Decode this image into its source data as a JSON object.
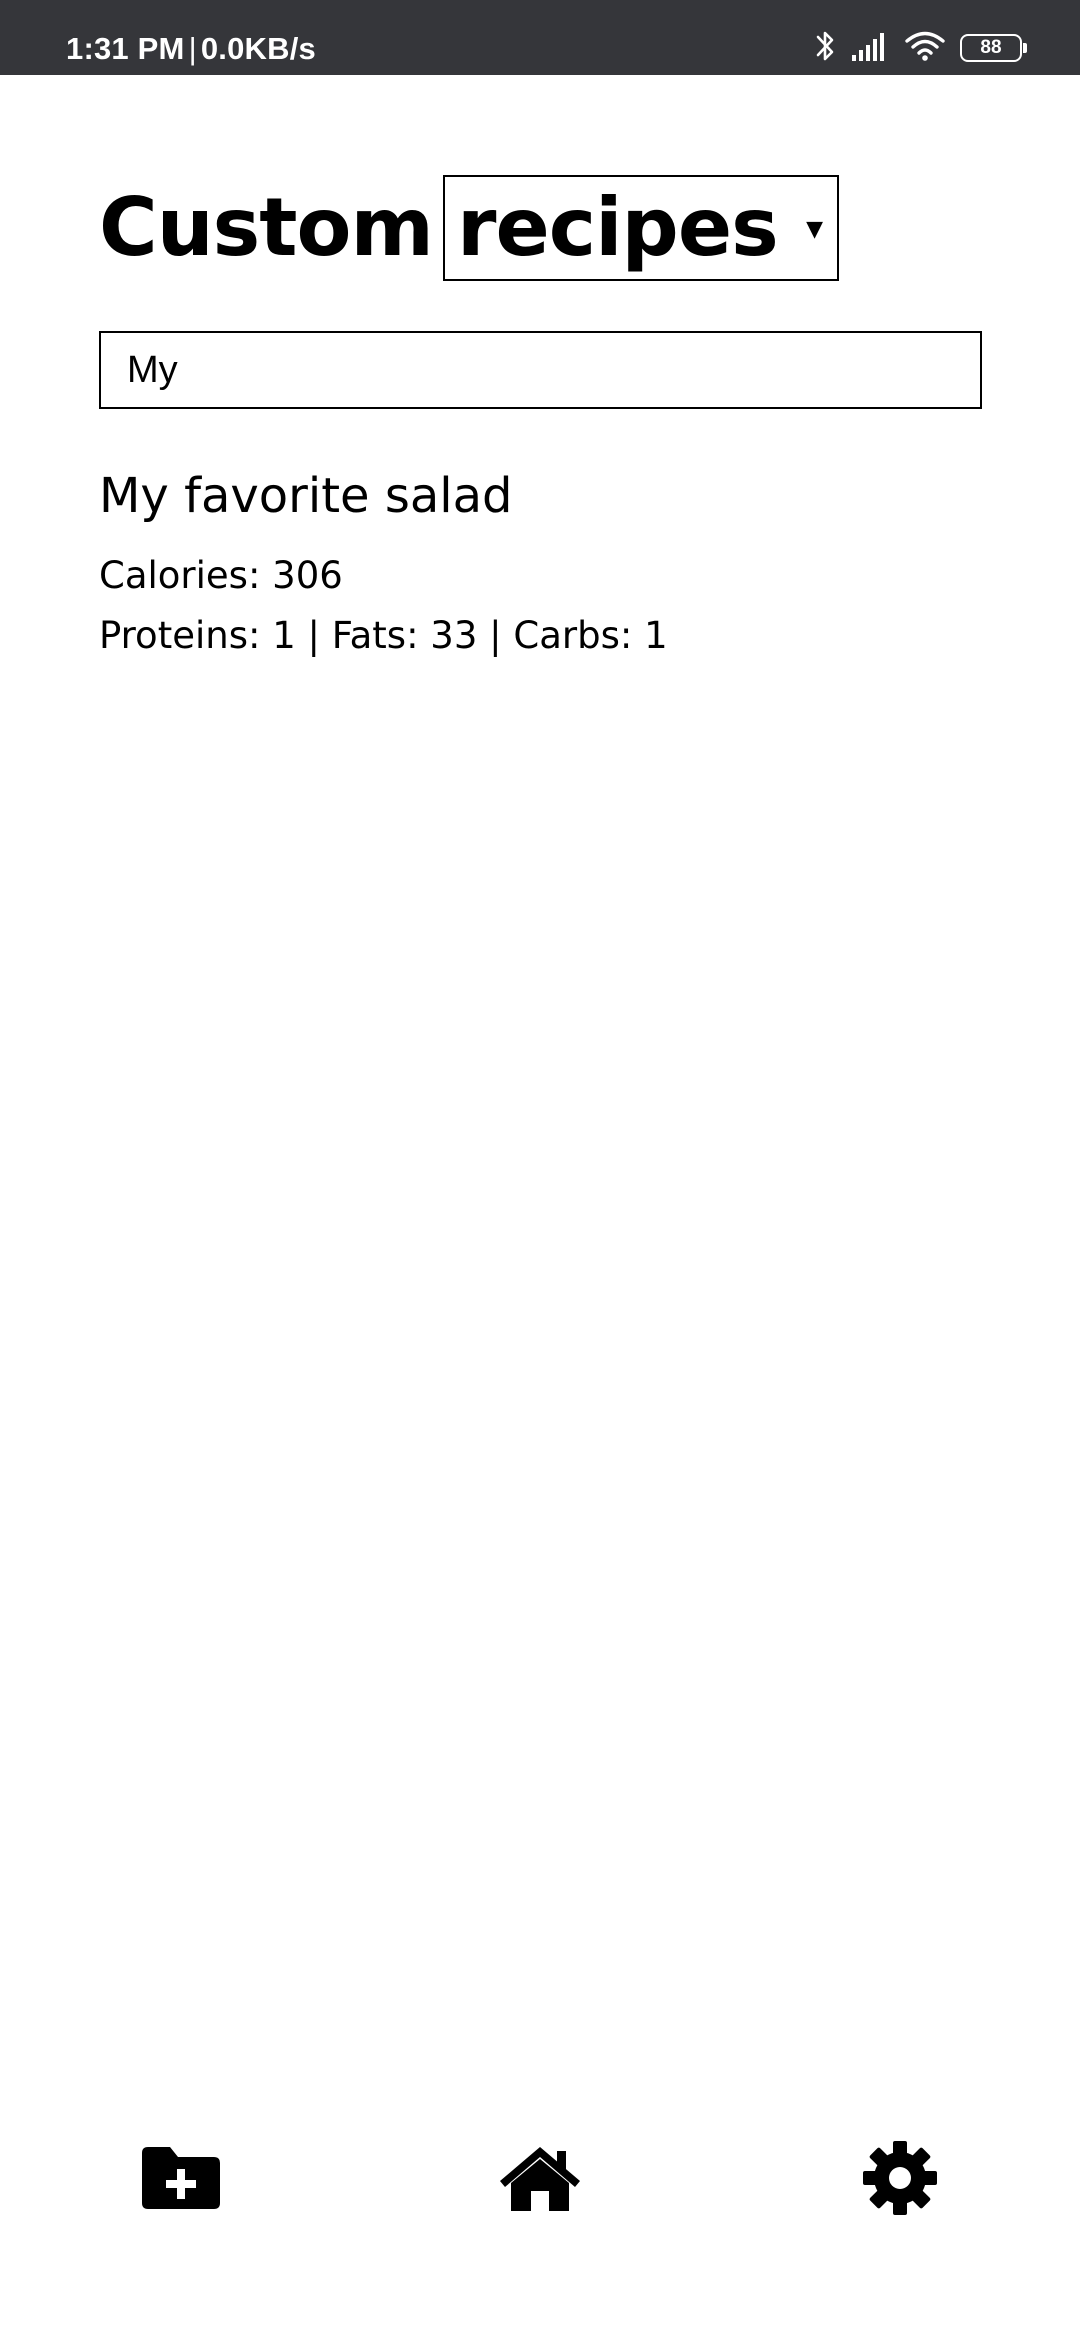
{
  "status_bar": {
    "time": "1:31 PM",
    "separator": "|",
    "network_speed": "0.0KB/s",
    "battery_level": "88",
    "icons": [
      "bluetooth-icon",
      "signal-icon",
      "wifi-icon",
      "battery-icon"
    ]
  },
  "header": {
    "title": "Custom",
    "category_select": {
      "selected": "recipes",
      "arrow": "▼"
    }
  },
  "search": {
    "value": "My"
  },
  "recipes": [
    {
      "name": "My favorite salad",
      "calories_line": "Calories: 306",
      "macros_line": "Proteins: 1 | Fats: 33 | Carbs: 1"
    }
  ],
  "bottom_nav": {
    "items": [
      {
        "icon": "folder-add-icon"
      },
      {
        "icon": "home-icon"
      },
      {
        "icon": "settings-gear-icon"
      }
    ]
  },
  "colors": {
    "status_bar_bg": "#35363a",
    "page_bg": "#ffffff",
    "text": "#000000"
  }
}
